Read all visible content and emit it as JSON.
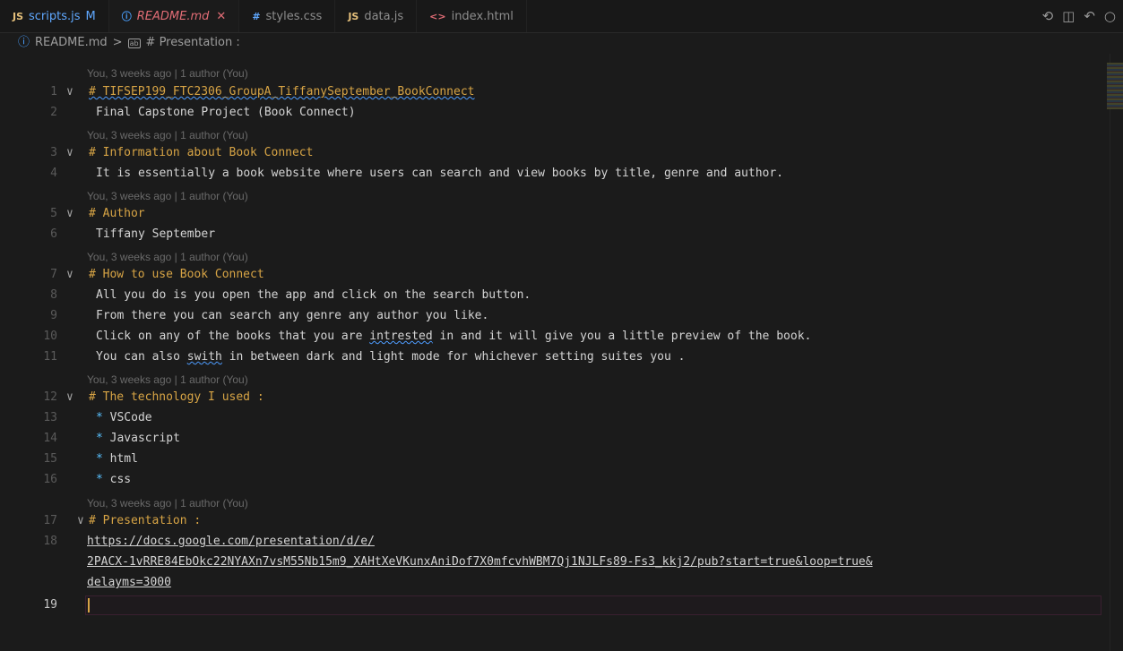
{
  "tabs": [
    {
      "icon": "JS",
      "label": "scripts.js",
      "suffix": "M"
    },
    {
      "icon": "ⓘ",
      "label": "README.md",
      "suffix": "✕"
    },
    {
      "icon": "#",
      "label": "styles.css",
      "suffix": ""
    },
    {
      "icon": "JS",
      "label": "data.js",
      "suffix": ""
    },
    {
      "icon": "<>",
      "label": "index.html",
      "suffix": ""
    }
  ],
  "tab_actions": [
    "history-icon",
    "split-editor-icon",
    "go-back-icon",
    "more-icon"
  ],
  "breadcrumb": {
    "file": "README.md",
    "separator": ">",
    "symbol": "# Presentation :"
  },
  "blame_text": "You, 3 weeks ago | 1 author (You)",
  "lines": {
    "l1": "# TIFSEP199_FTC2306_GroupA_TiffanySeptember_BookConnect",
    "l2": "Final Capstone Project (Book Connect)",
    "l3": "# Information about Book Connect",
    "l4": "It is essentially a book website where users can search and view books by title, genre and author.",
    "l5": "# Author",
    "l6": "Tiffany September",
    "l7": "# How to use Book Connect",
    "l8": "All you do is you open the app and click on the search button.",
    "l9": "From there you can search any genre any author you like.",
    "l10a": "Click on any of the books that you are ",
    "l10b": "intrested",
    "l10c": " in and it will give you a little preview of the book.",
    "l11a": "You can also ",
    "l11b": "swith",
    "l11c": " in between dark and light mode for whichever setting suites you .",
    "l12": "# The technology I used :",
    "l13": "VSCode",
    "l14": "Javascript",
    "l15": "html",
    "l16": "css",
    "l17": "# Presentation :",
    "l18a": "https://docs.google.com/presentation/d/e/",
    "l18b": "2PACX-1vRRE84EbOkc22NYAXn7vsM55Nb15m9_XAHtXeVKunxAniDof7X0mfcvhWBM7Qj1NJLFs89-Fs3_kkj2/pub?start=true&loop=true&",
    "l18c": "delayms=3000"
  },
  "line_numbers": [
    "1",
    "2",
    "3",
    "4",
    "5",
    "6",
    "7",
    "8",
    "9",
    "10",
    "11",
    "12",
    "13",
    "14",
    "15",
    "16",
    "17",
    "18",
    "19"
  ],
  "bullet": "*",
  "colors": {
    "heading": "#d7a445",
    "text": "#d4d4d4",
    "bullet": "#59c1ff",
    "blame": "#6a6a6a"
  }
}
